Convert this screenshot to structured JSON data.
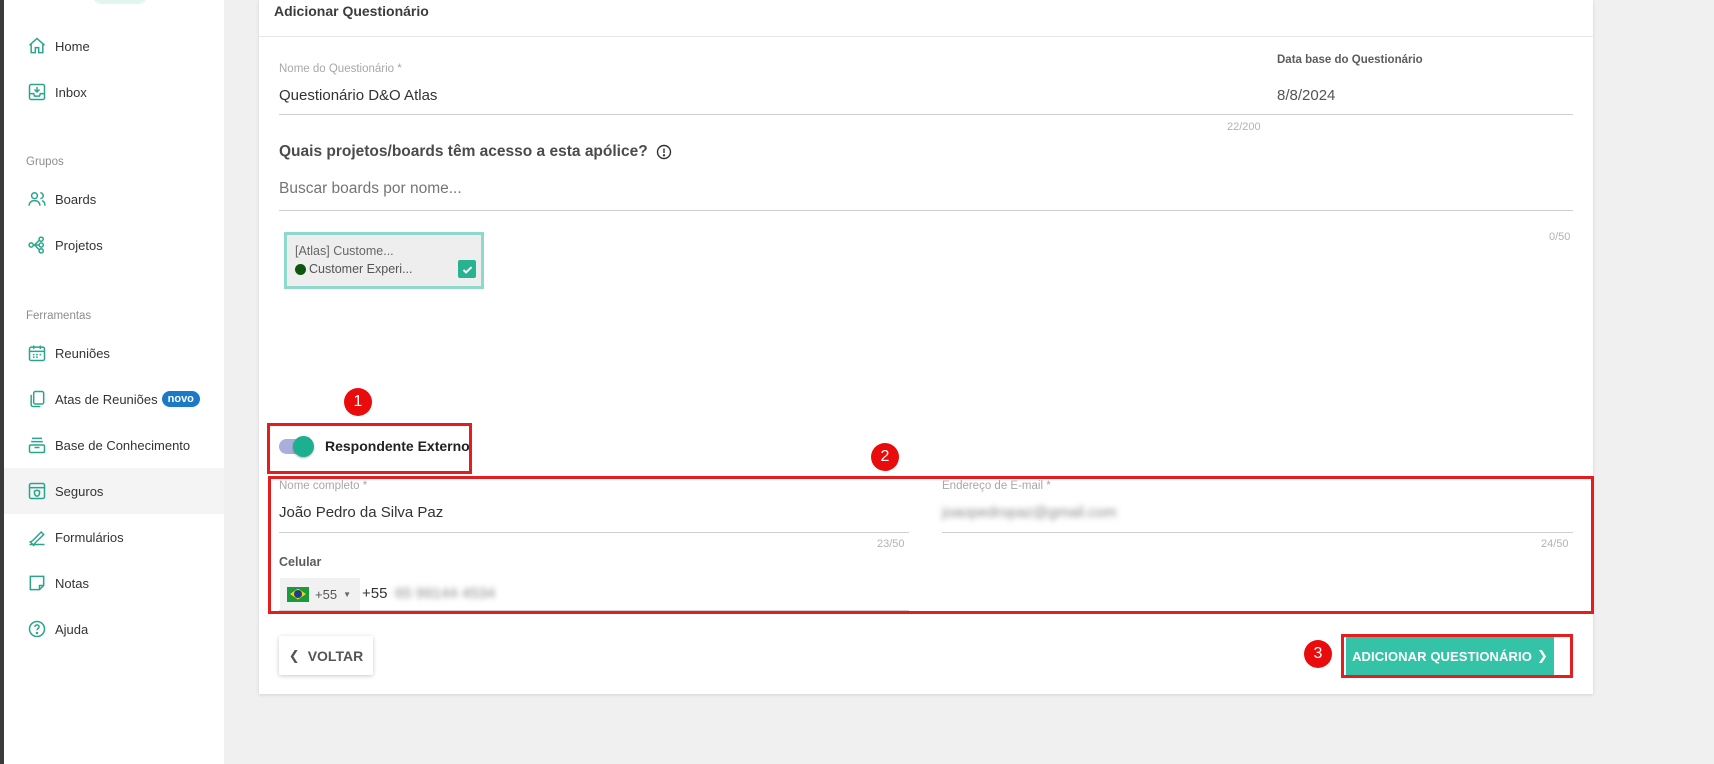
{
  "sidebar": {
    "items": [
      {
        "label": "Home",
        "icon": "home-icon"
      },
      {
        "label": "Inbox",
        "icon": "inbox-icon"
      },
      {
        "label": "Boards",
        "icon": "users-icon"
      },
      {
        "label": "Projetos",
        "icon": "project-tree-icon"
      },
      {
        "label": "Reuniões",
        "icon": "calendar-icon"
      },
      {
        "label": "Atas de Reuniões",
        "icon": "copy-icon",
        "badge": "novo"
      },
      {
        "label": "Base de Conhecimento",
        "icon": "archive-icon"
      },
      {
        "label": "Seguros",
        "icon": "insurance-icon",
        "active": true
      },
      {
        "label": "Formulários",
        "icon": "signature-icon"
      },
      {
        "label": "Notas",
        "icon": "note-icon"
      },
      {
        "label": "Ajuda",
        "icon": "help-icon"
      }
    ],
    "sections": {
      "grupos": "Grupos",
      "ferramentas": "Ferramentas"
    }
  },
  "form": {
    "title": "Adicionar Questionário",
    "name_label": "Nome do Questionário *",
    "name_value": "Questionário D&O Atlas",
    "name_counter": "22/200",
    "date_label": "Data base do Questionário",
    "date_value": "8/8/2024",
    "projects_question": "Quais projetos/boards têm acesso a esta apólice?",
    "search_placeholder": "Buscar boards por nome...",
    "boards_counter": "0/50",
    "chip": {
      "title": "[Atlas] Custome...",
      "subtitle": "Customer Experi...",
      "checked": true
    },
    "external_toggle_label": "Respondente Externo",
    "external_toggle_on": true,
    "fullname_label": "Nome completo *",
    "fullname_value": "João Pedro da Silva Paz",
    "fullname_counter": "23/50",
    "email_label": "Endereço de E-mail *",
    "email_value": "joaopedropaz@gmail.com",
    "email_counter": "24/50",
    "phone_label": "Celular",
    "phone_country_code": "+55",
    "phone_prefix": "+55",
    "phone_number": "65 99144 4534",
    "back_button": "VOLTAR",
    "submit_button": "ADICIONAR QUESTIONÁRIO"
  },
  "annotations": [
    "1",
    "2",
    "3"
  ],
  "colors": {
    "accent": "#35c3a8",
    "annotation_red": "#e41e1e",
    "badge_blue": "#1b79c8"
  }
}
